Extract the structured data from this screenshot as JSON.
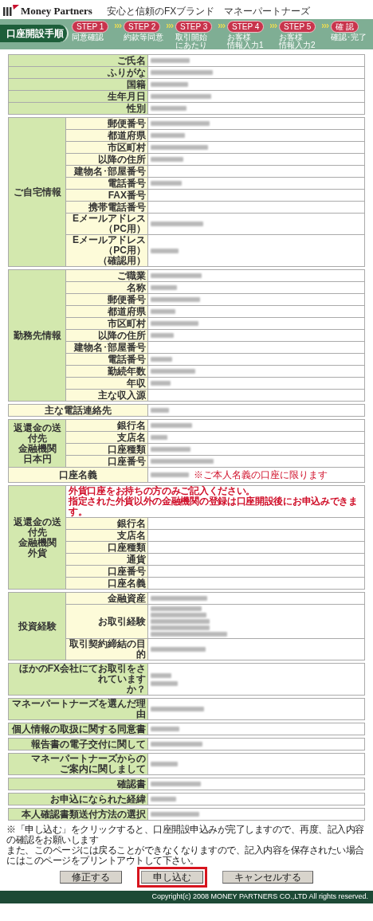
{
  "header": {
    "brand": "Money Partners",
    "tagline": "安心と信頼のFXブランド　マネーパートナーズ"
  },
  "steps_bar": {
    "title": "口座開設手順",
    "steps": [
      {
        "pill": "STEP 1",
        "caption": [
          "同意確認"
        ]
      },
      {
        "pill": "STEP 2",
        "caption": [
          "約款等同意"
        ]
      },
      {
        "pill": "STEP 3",
        "caption": [
          "取引開始",
          "にあたり"
        ]
      },
      {
        "pill": "STEP 4",
        "caption": [
          "お客様",
          "情報入力1"
        ]
      },
      {
        "pill": "STEP 5",
        "caption": [
          "お客様",
          "情報入力2"
        ]
      },
      {
        "pill": "確 認",
        "caption": [
          "確認･完了"
        ]
      }
    ]
  },
  "sections": [
    {
      "kind": "single",
      "rows": [
        {
          "label": [
            "ご氏名"
          ],
          "kind": "blurred"
        },
        {
          "label": [
            "ふりがな"
          ],
          "kind": "blurred"
        },
        {
          "label": [
            "国籍"
          ],
          "kind": "blurred"
        },
        {
          "label": [
            "生年月日"
          ],
          "kind": "blurred"
        },
        {
          "label": [
            "性別"
          ],
          "kind": "blurred"
        }
      ]
    },
    {
      "kind": "group",
      "group": [
        "ご自宅情報"
      ],
      "rows": [
        {
          "label": [
            "郵便番号"
          ],
          "kind": "blurred"
        },
        {
          "label": [
            "都道府県"
          ],
          "kind": "blurred"
        },
        {
          "label": [
            "市区町村"
          ],
          "kind": "blurred"
        },
        {
          "label": [
            "以降の住所"
          ],
          "kind": "blurred"
        },
        {
          "label": [
            "建物名･部屋番号"
          ],
          "kind": "empty"
        },
        {
          "label": [
            "電話番号"
          ],
          "kind": "blurred"
        },
        {
          "label": [
            "FAX番号"
          ],
          "kind": "empty"
        },
        {
          "label": [
            "携帯電話番号"
          ],
          "kind": "empty"
        },
        {
          "label": [
            "Eメールアドレス",
            "（PC用）"
          ],
          "kind": "blurred"
        },
        {
          "label": [
            "Eメールアドレス",
            "（PC用）",
            "（確認用）"
          ],
          "kind": "blurred"
        }
      ]
    },
    {
      "kind": "group",
      "group": [
        "勤務先情報"
      ],
      "rows": [
        {
          "label": [
            "ご職業"
          ],
          "kind": "blurred"
        },
        {
          "label": [
            "名称"
          ],
          "kind": "blurred"
        },
        {
          "label": [
            "郵便番号"
          ],
          "kind": "blurred"
        },
        {
          "label": [
            "都道府県"
          ],
          "kind": "blurred"
        },
        {
          "label": [
            "市区町村"
          ],
          "kind": "blurred"
        },
        {
          "label": [
            "以降の住所"
          ],
          "kind": "blurred"
        },
        {
          "label": [
            "建物名･部屋番号"
          ],
          "kind": "empty"
        },
        {
          "label": [
            "電話番号"
          ],
          "kind": "blurred"
        },
        {
          "label": [
            "勤続年数"
          ],
          "kind": "blurred"
        },
        {
          "label": [
            "年収"
          ],
          "kind": "blurred"
        },
        {
          "label": [
            "主な収入源"
          ],
          "kind": "empty"
        }
      ]
    },
    {
      "kind": "band",
      "rows": [
        {
          "label": [
            "主な電話連絡先"
          ],
          "kind": "blurred"
        }
      ]
    },
    {
      "kind": "group",
      "group": [
        "返還金の送付先",
        "金融機関",
        "日本円"
      ],
      "rows": [
        {
          "label": [
            "銀行名"
          ],
          "kind": "blurred"
        },
        {
          "label": [
            "支店名"
          ],
          "kind": "blurred"
        },
        {
          "label": [
            "口座種類"
          ],
          "kind": "blurred"
        },
        {
          "label": [
            "口座番号"
          ],
          "kind": "blurred"
        }
      ],
      "tail": [
        {
          "label": [
            "口座名義"
          ],
          "kind": "blurred",
          "note": "※ご本人名義の口座に限ります"
        }
      ]
    },
    {
      "kind": "group",
      "group": [
        "返還金の送付先",
        "金融機関",
        "外貨"
      ],
      "notice": [
        "外貨口座をお持ちの方のみご記入ください。",
        "指定された外貨以外の金融機関の登録は口座開設後にお申込みできます。"
      ],
      "rows": [
        {
          "label": [
            "銀行名"
          ],
          "kind": "empty"
        },
        {
          "label": [
            "支店名"
          ],
          "kind": "empty"
        },
        {
          "label": [
            "口座種類"
          ],
          "kind": "empty"
        },
        {
          "label": [
            "通貨"
          ],
          "kind": "empty"
        },
        {
          "label": [
            "口座番号"
          ],
          "kind": "empty"
        },
        {
          "label": [
            "口座名義"
          ],
          "kind": "empty"
        }
      ]
    },
    {
      "kind": "group",
      "group": [
        "投資経験"
      ],
      "rows": [
        {
          "label": [
            "金融資産"
          ],
          "kind": "blurred"
        },
        {
          "label": [
            "お取引経験"
          ],
          "kind": "blurred_block"
        },
        {
          "label": [
            "取引契約締結の目的"
          ],
          "kind": "blurred"
        }
      ]
    },
    {
      "kind": "single",
      "rows": [
        {
          "label": [
            "ほかのFX会社にてお取引をされています",
            "か？"
          ],
          "kind": "blurred_pair"
        }
      ]
    },
    {
      "kind": "single",
      "rows": [
        {
          "label": [
            "マネーパートナーズを選んだ理由"
          ],
          "kind": "blurred"
        }
      ]
    },
    {
      "kind": "single",
      "rows": [
        {
          "label": [
            "個人情報の取扱に関する同意書"
          ],
          "kind": "blurred"
        }
      ]
    },
    {
      "kind": "single",
      "rows": [
        {
          "label": [
            "報告書の電子交付に関して"
          ],
          "kind": "blurred"
        }
      ]
    },
    {
      "kind": "single",
      "rows": [
        {
          "label": [
            "マネーパートナーズからの",
            "ご案内に関しまして"
          ],
          "kind": "blurred"
        }
      ]
    },
    {
      "kind": "single",
      "rows": [
        {
          "label": [
            "確認書"
          ],
          "kind": "blurred"
        }
      ]
    },
    {
      "kind": "single",
      "rows": [
        {
          "label": [
            "お申込になられた経緯"
          ],
          "kind": "blurred"
        }
      ]
    },
    {
      "kind": "single",
      "rows": [
        {
          "label": [
            "本人確認書類送付方法の選択"
          ],
          "kind": "blurred"
        }
      ]
    }
  ],
  "notes": [
    "※「申し込む」をクリックすると、口座開設申込みが完了しますので、再度、記入内容の確認をお願いします",
    "また、このページには戻ることができなくなりますので、記入内容を保存されたい場合にはこのページをプリントアウトして下さい。"
  ],
  "buttons": [
    {
      "label": "修正する",
      "highlighted": false
    },
    {
      "label": "申し込む",
      "highlighted": true
    },
    {
      "label": "キャンセルする",
      "highlighted": false
    }
  ],
  "footer": "Copyright(c) 2008 MONEY PARTNERS CO.,LTD All rights reserved."
}
